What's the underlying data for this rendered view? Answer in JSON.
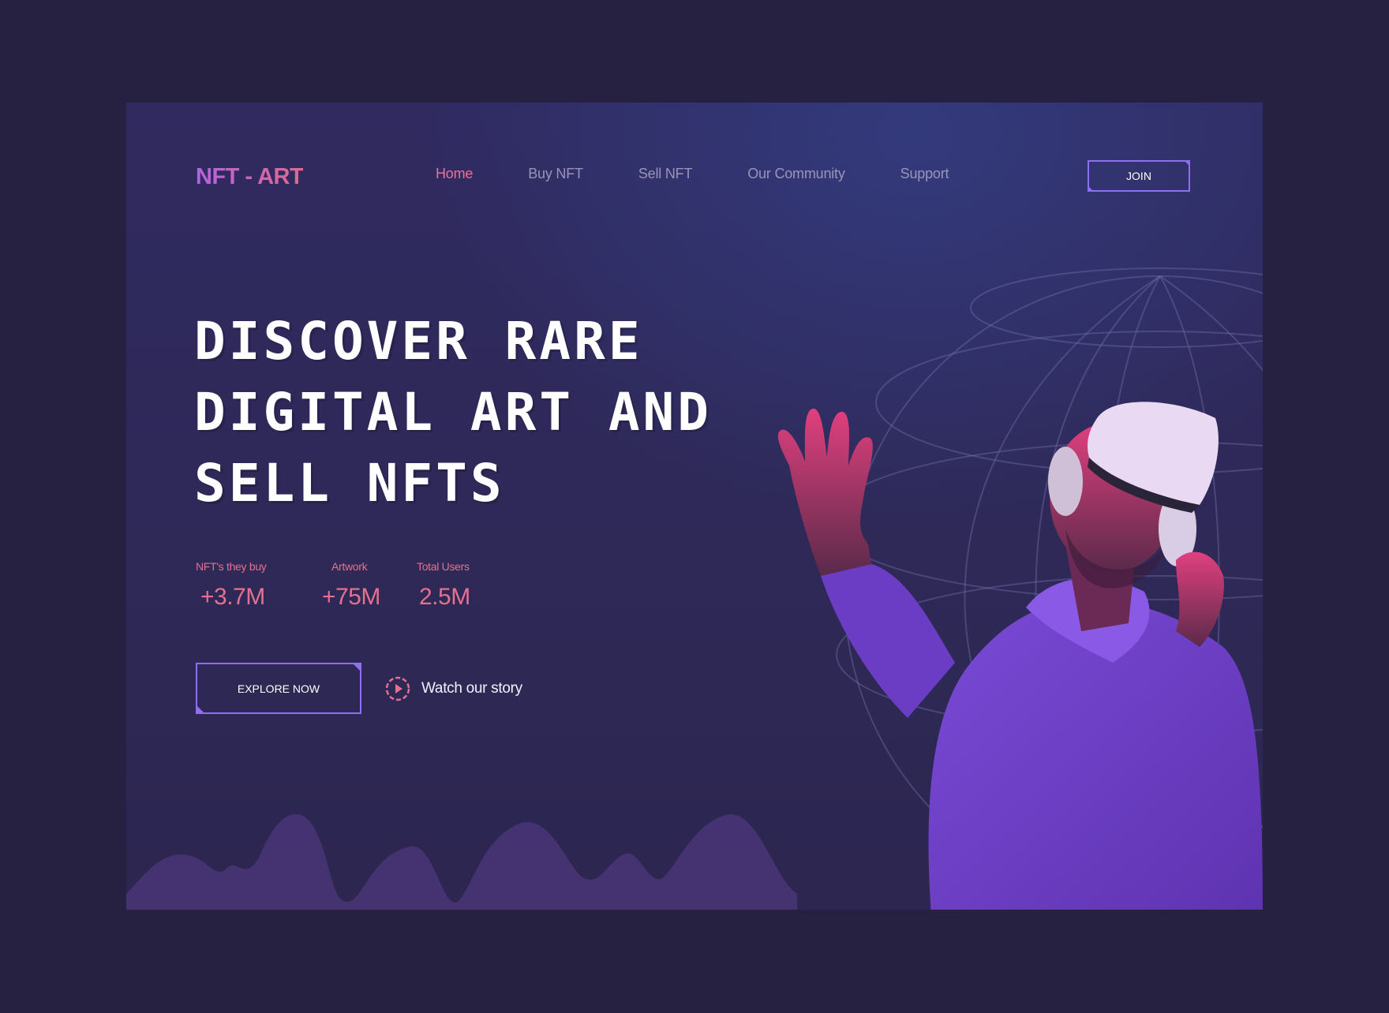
{
  "brand": {
    "logo": "NFT - ART"
  },
  "nav": {
    "items": [
      {
        "label": "Home",
        "active": true
      },
      {
        "label": "Buy NFT",
        "active": false
      },
      {
        "label": "Sell NFT",
        "active": false
      },
      {
        "label": "Our Community",
        "active": false
      },
      {
        "label": "Support",
        "active": false
      }
    ],
    "join_label": "JOIN"
  },
  "hero": {
    "title_lines": [
      "DISCOVER RARE",
      "DIGITAL ART AND",
      "SELL NFTS"
    ],
    "stats": [
      {
        "label": "NFT's they buy",
        "value": "+3.7M"
      },
      {
        "label": "Artwork",
        "value": "+75M"
      },
      {
        "label": "Total Users",
        "value": "2.5M"
      }
    ],
    "explore_label": "EXPLORE NOW",
    "watch_label": "Watch our story"
  },
  "colors": {
    "page_bg": "#262140",
    "accent_pink": "#e57190",
    "accent_purple": "#8d6ff0",
    "nav_inactive": "#9a95b8"
  },
  "icons": [
    "play-circle-icon",
    "globe-wireframe",
    "vr-headset-person-illustration"
  ]
}
